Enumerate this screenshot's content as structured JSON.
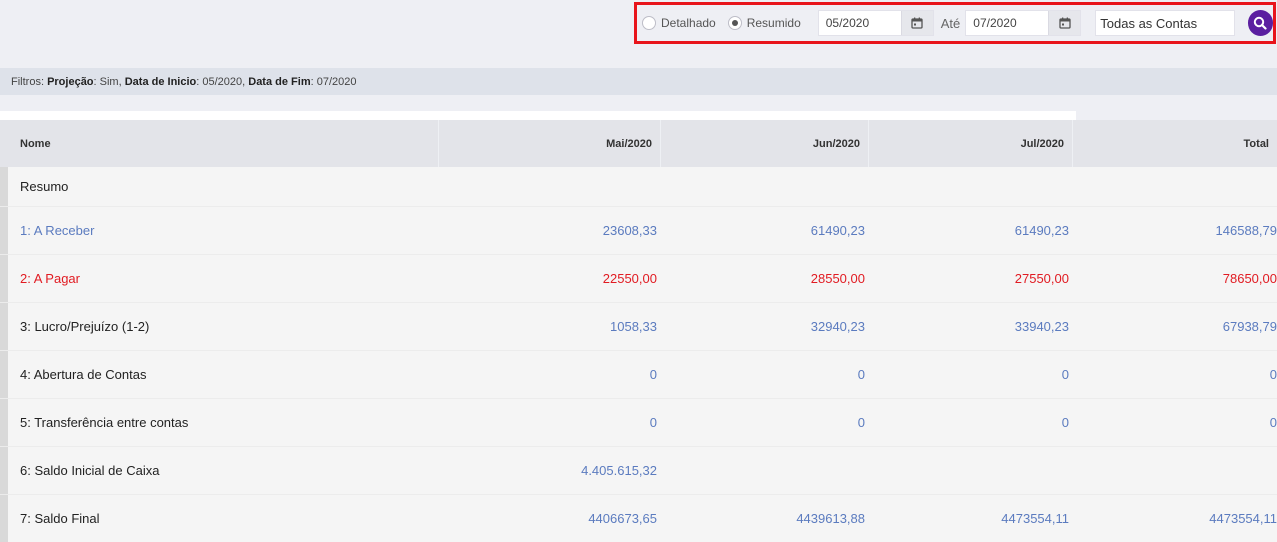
{
  "toolbar": {
    "radio_detalhado": "Detalhado",
    "radio_resumido": "Resumido",
    "selected_mode": "Resumido",
    "date_from": "05/2020",
    "until_label": "Até",
    "date_to": "07/2020",
    "account_select": "Todas as Contas",
    "search_icon": "search-icon",
    "calendar_icon": "calendar-icon",
    "accent_color": "#5b1fa0",
    "highlight_border_color": "#e8141b"
  },
  "filters": {
    "prefix": "Filtros: ",
    "projecao_label": "Projeção",
    "projecao_value": ": Sim, ",
    "inicio_label": "Data de Inicio",
    "inicio_value": ": 05/2020, ",
    "fim_label": "Data de Fim",
    "fim_value": ": 07/2020"
  },
  "table": {
    "headers": [
      "Nome",
      "Mai/2020",
      "Jun/2020",
      "Jul/2020",
      "Total"
    ],
    "section_title": "Resumo",
    "rows": [
      {
        "name": "1: A Receber",
        "values": [
          "23608,33",
          "61490,23",
          "61490,23",
          "146588,79"
        ],
        "style": "blue"
      },
      {
        "name": "2: A Pagar",
        "values": [
          "22550,00",
          "28550,00",
          "27550,00",
          "78650,00"
        ],
        "style": "red"
      },
      {
        "name": "3: Lucro/Prejuízo (1-2)",
        "values": [
          "1058,33",
          "32940,23",
          "33940,23",
          "67938,79"
        ],
        "style": "plain"
      },
      {
        "name": "4: Abertura de Contas",
        "values": [
          "0",
          "0",
          "0",
          "0"
        ],
        "style": "plain"
      },
      {
        "name": "5: Transferência entre contas",
        "values": [
          "0",
          "0",
          "0",
          "0"
        ],
        "style": "plain"
      },
      {
        "name": "6: Saldo Inicial de Caixa",
        "values": [
          "4.405.615,32",
          "",
          "",
          ""
        ],
        "style": "plain"
      },
      {
        "name": "7: Saldo Final",
        "values": [
          "4406673,65",
          "4439613,88",
          "4473554,11",
          "4473554,11"
        ],
        "style": "plain"
      }
    ],
    "colors": {
      "blue": "#5b7bbf",
      "red": "#e11b22"
    }
  }
}
